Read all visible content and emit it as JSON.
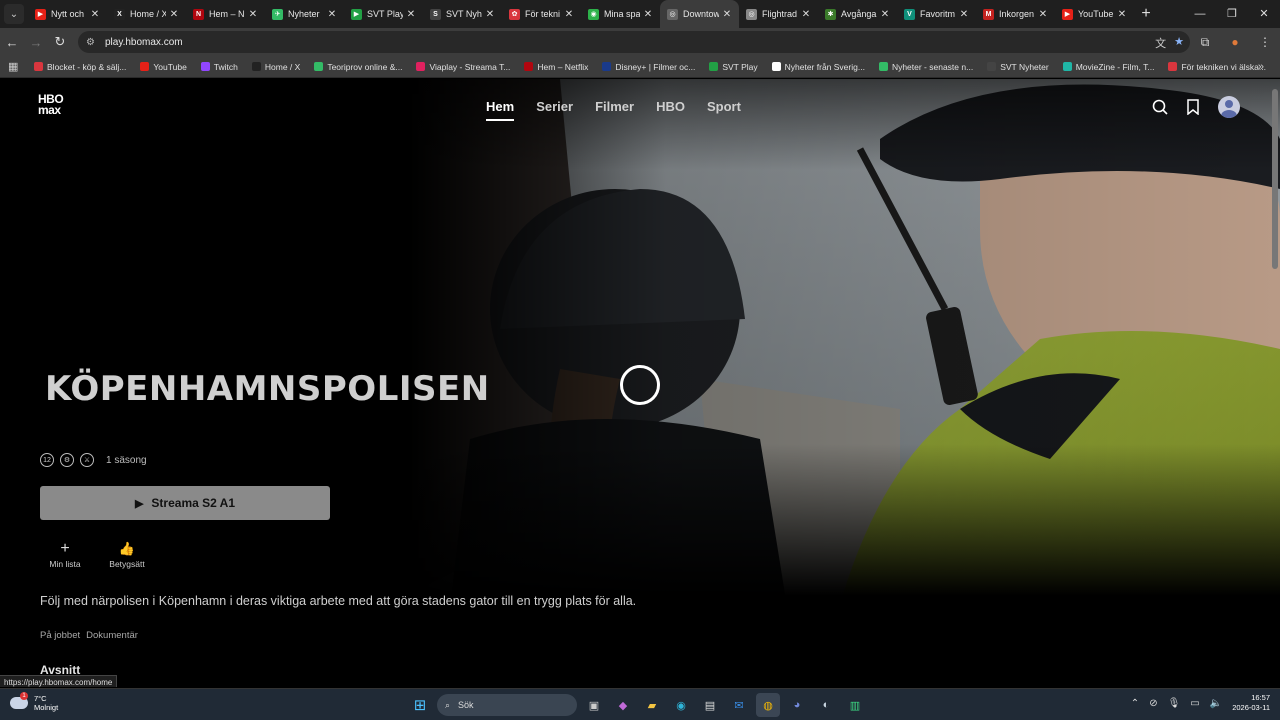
{
  "browser": {
    "tabs": [
      {
        "title": "Nytt och",
        "color": "#e62117",
        "glyph": "▶"
      },
      {
        "title": "Home / X",
        "color": "#222222",
        "glyph": "X"
      },
      {
        "title": "Hem – N",
        "color": "#b1060f",
        "glyph": "N"
      },
      {
        "title": "Nyheter",
        "color": "#3b6",
        "glyph": "✈"
      },
      {
        "title": "SVT Play",
        "color": "#22a045",
        "glyph": "▶"
      },
      {
        "title": "SVT Nyh",
        "color": "#444444",
        "glyph": "S"
      },
      {
        "title": "För tekni",
        "color": "#d9363e",
        "glyph": "✿"
      },
      {
        "title": "Mina spa",
        "color": "#2db24a",
        "glyph": "◉"
      },
      {
        "title": "Downtow",
        "color": "#666666",
        "glyph": "◎"
      },
      {
        "title": "Flightrad",
        "color": "#888888",
        "glyph": "◎"
      },
      {
        "title": "Avgånga",
        "color": "#3a7a2a",
        "glyph": "✱"
      },
      {
        "title": "Favoritm",
        "color": "#0f8f7a",
        "glyph": "V"
      },
      {
        "title": "Inkorgen",
        "color": "#c5221f",
        "glyph": "M"
      },
      {
        "title": "YouTube",
        "color": "#e62117",
        "glyph": "▶"
      }
    ],
    "active_tab_index": 8,
    "url": "play.hbomax.com",
    "bookmarks": [
      {
        "label": "Blocket - köp & sälj...",
        "color": "#d9363e"
      },
      {
        "label": "YouTube",
        "color": "#e62117"
      },
      {
        "label": "Twitch",
        "color": "#9146ff"
      },
      {
        "label": "Home / X",
        "color": "#222222"
      },
      {
        "label": "Teoriprov online &...",
        "color": "#3b6"
      },
      {
        "label": "Viaplay - Streama T...",
        "color": "#e0215f"
      },
      {
        "label": "Hem – Netflix",
        "color": "#b1060f"
      },
      {
        "label": "Disney+ | Filmer oc...",
        "color": "#1a3a8a"
      },
      {
        "label": "SVT Play",
        "color": "#22a045"
      },
      {
        "label": "Nyheter från Sverig...",
        "color": "#ffffff"
      },
      {
        "label": "Nyheter - senaste n...",
        "color": "#3b6"
      },
      {
        "label": "SVT Nyheter",
        "color": "#444444"
      },
      {
        "label": "MovieZine - Film, T...",
        "color": "#1fb6a6"
      },
      {
        "label": "För tekniken vi älska...",
        "color": "#d9363e"
      }
    ],
    "status_url": "https://play.hbomax.com/home"
  },
  "page": {
    "logo_line1": "HBO",
    "logo_line2": "max",
    "nav": [
      "Hem",
      "Serier",
      "Filmer",
      "HBO",
      "Sport"
    ],
    "active_nav_index": 0,
    "show_title": "KÖPENHAMNSPOLISEN",
    "ratings": [
      "12",
      "⚙",
      "⚔"
    ],
    "seasons": "1 säsong",
    "stream_label": "Streama S2 A1",
    "actions": [
      {
        "icon": "+",
        "label": "Min lista"
      },
      {
        "icon": "👍",
        "label": "Betygsätt"
      }
    ],
    "description": "Följ med närpolisen i Köpenhamn i deras viktiga arbete med att göra stadens gator till en trygg plats för alla.",
    "genres": [
      "På jobbet",
      "Dokumentär"
    ],
    "section_title": "Avsnitt"
  },
  "taskbar": {
    "temp": "7°C",
    "weather": "Molnigt",
    "weather_badge": "1",
    "search_label": "Sök",
    "time": "16:57",
    "date": "2026-03-11"
  }
}
